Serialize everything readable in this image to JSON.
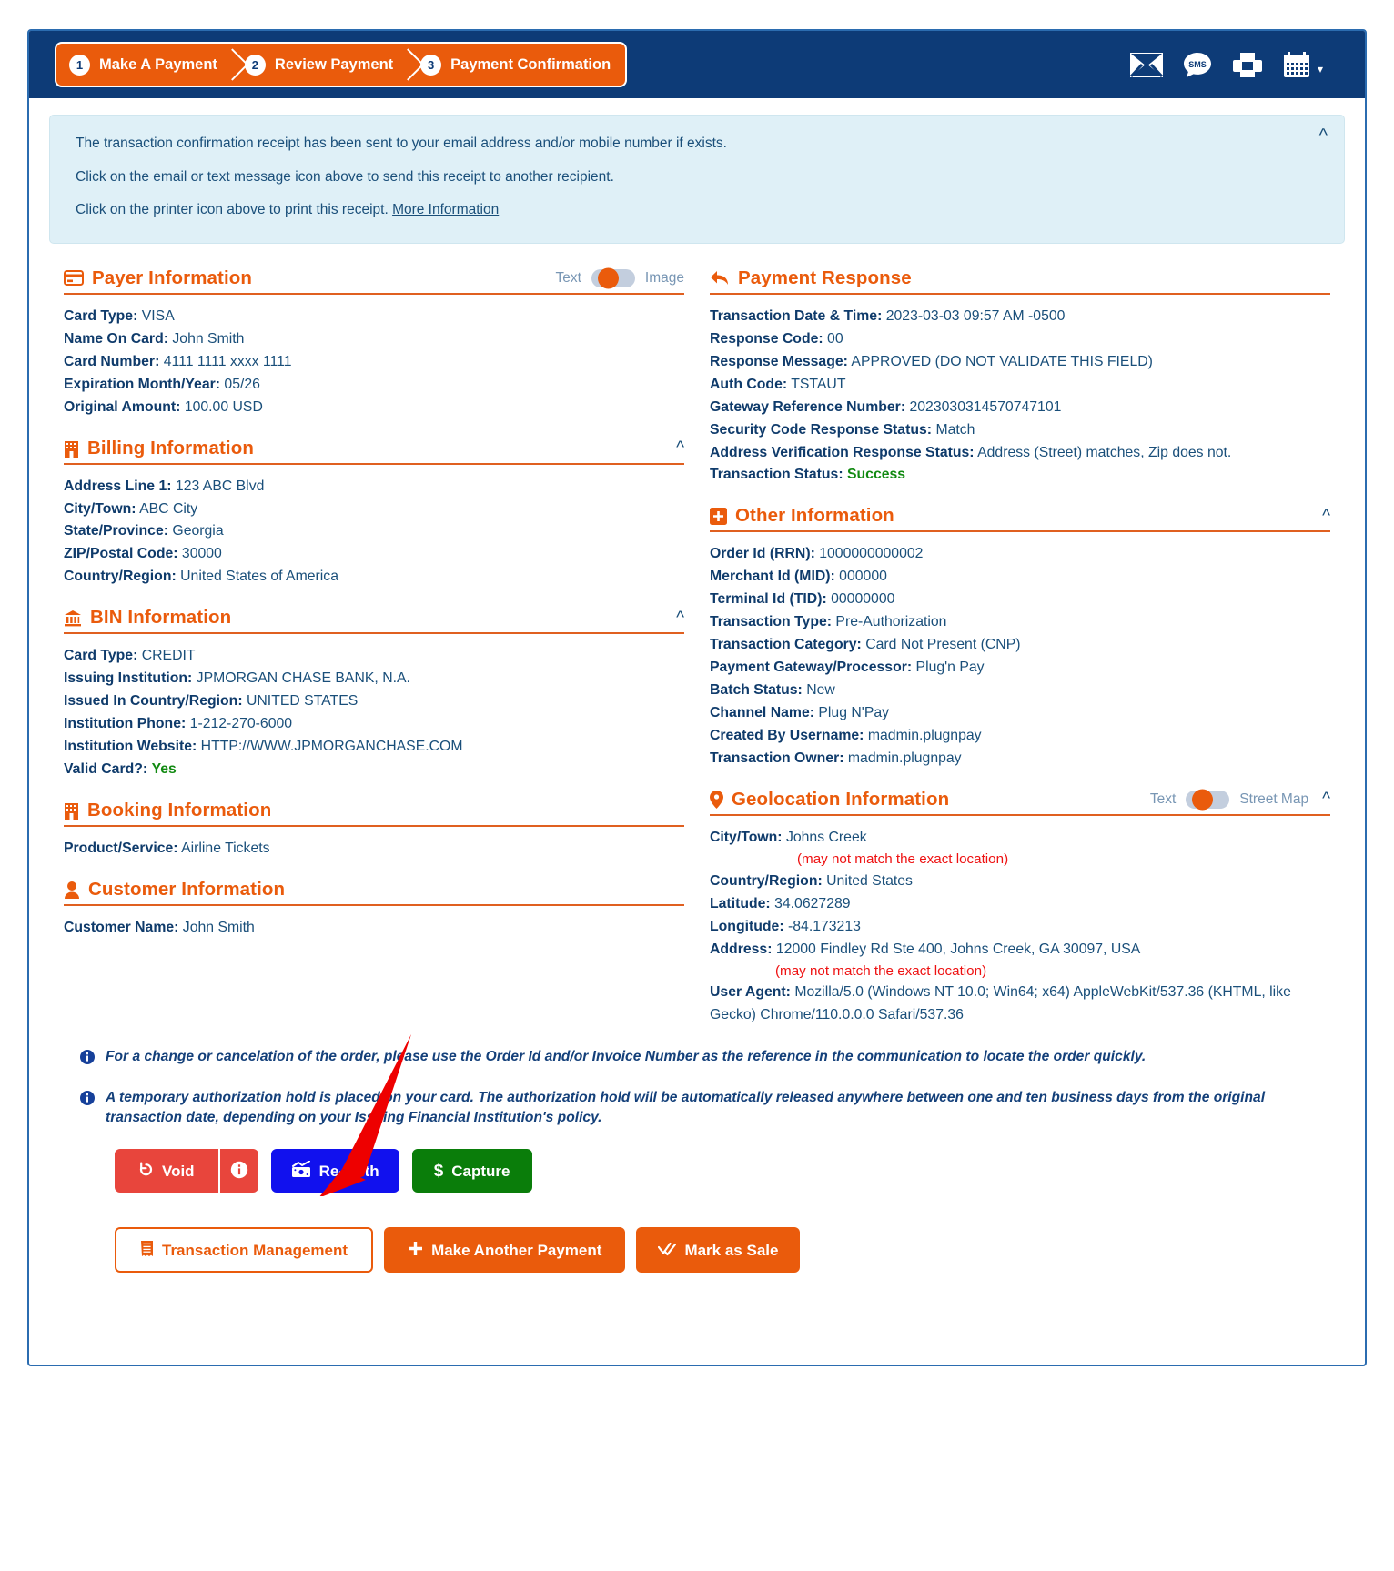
{
  "wizard": {
    "steps": [
      {
        "num": "1",
        "label": "Make A Payment"
      },
      {
        "num": "2",
        "label": "Review Payment"
      },
      {
        "num": "3",
        "label": "Payment Confirmation"
      }
    ]
  },
  "topbar": {
    "icons": [
      "email-icon",
      "sms-icon",
      "printer-icon",
      "calendar-icon"
    ],
    "accent": "#ea5b0c",
    "background": "#0d3b77"
  },
  "notice": {
    "line1": "The transaction confirmation receipt has been sent to your email address and/or mobile number if exists.",
    "line2": "Click on the email or text message icon above to send this receipt to another recipient.",
    "line3_prefix": "Click on the printer icon above to print this receipt. ",
    "line3_link": "More Information"
  },
  "sections": {
    "payer": {
      "title": "Payer Information",
      "toggle_left": "Text",
      "toggle_right": "Image",
      "fields": [
        {
          "k": "Card Type:",
          "v": "VISA"
        },
        {
          "k": "Name On Card:",
          "v": "John Smith"
        },
        {
          "k": "Card Number:",
          "v": "4111 1111 xxxx 1111"
        },
        {
          "k": "Expiration Month/Year:",
          "v": "05/26"
        },
        {
          "k": "Original Amount:",
          "v": "100.00 USD"
        }
      ]
    },
    "billing": {
      "title": "Billing Information",
      "fields": [
        {
          "k": "Address Line 1:",
          "v": "123 ABC Blvd"
        },
        {
          "k": "City/Town:",
          "v": "ABC City"
        },
        {
          "k": "State/Province:",
          "v": "Georgia"
        },
        {
          "k": "ZIP/Postal Code:",
          "v": "30000"
        },
        {
          "k": "Country/Region:",
          "v": "United States of America"
        }
      ]
    },
    "bin": {
      "title": "BIN Information",
      "fields": [
        {
          "k": "Card Type:",
          "v": "CREDIT"
        },
        {
          "k": "Issuing Institution:",
          "v": "JPMORGAN CHASE BANK, N.A."
        },
        {
          "k": "Issued In Country/Region:",
          "v": "UNITED STATES"
        },
        {
          "k": "Institution Phone:",
          "v": "1-212-270-6000"
        },
        {
          "k": "Institution Website:",
          "v": "HTTP://WWW.JPMORGANCHASE.COM"
        },
        {
          "k": "Valid Card?:",
          "v": "Yes",
          "style": "green"
        }
      ]
    },
    "booking": {
      "title": "Booking Information",
      "fields": [
        {
          "k": "Product/Service:",
          "v": "Airline Tickets"
        }
      ]
    },
    "customer": {
      "title": "Customer Information",
      "fields": [
        {
          "k": "Customer Name:",
          "v": "John Smith"
        }
      ]
    },
    "payment_response": {
      "title": "Payment Response",
      "fields": [
        {
          "k": "Transaction Date & Time:",
          "v": "2023-03-03 09:57 AM -0500"
        },
        {
          "k": "Response Code:",
          "v": "00"
        },
        {
          "k": "Response Message:",
          "v": "APPROVED (DO NOT VALIDATE THIS FIELD)"
        },
        {
          "k": "Auth Code:",
          "v": "TSTAUT"
        },
        {
          "k": "Gateway Reference Number:",
          "v": "2023030314570747101"
        },
        {
          "k": "Security Code Response Status:",
          "v": "Match"
        },
        {
          "k": "Address Verification Response Status:",
          "v": "Address (Street) matches, Zip does not."
        },
        {
          "k": "Transaction Status:",
          "v": "Success",
          "style": "green"
        }
      ]
    },
    "other": {
      "title": "Other Information",
      "fields": [
        {
          "k": "Order Id (RRN):",
          "v": "1000000000002"
        },
        {
          "k": "Merchant Id (MID):",
          "v": "000000"
        },
        {
          "k": "Terminal Id (TID):",
          "v": "00000000"
        },
        {
          "k": "Transaction Type:",
          "v": "Pre-Authorization"
        },
        {
          "k": "Transaction Category:",
          "v": "Card Not Present (CNP)"
        },
        {
          "k": "Payment Gateway/Processor:",
          "v": "Plug'n Pay"
        },
        {
          "k": "Batch Status:",
          "v": "New"
        },
        {
          "k": "Channel Name:",
          "v": "Plug N'Pay"
        },
        {
          "k": "Created By Username:",
          "v": "madmin.plugnpay"
        },
        {
          "k": "Transaction Owner:",
          "v": "madmin.plugnpay"
        }
      ]
    },
    "geolocation": {
      "title": "Geolocation Information",
      "toggle_left": "Text",
      "toggle_right": "Street Map",
      "city_key": "City/Town:",
      "city_value": "Johns Creek",
      "city_note": "(may not match the exact location)",
      "country_key": "Country/Region:",
      "country_value": "United States",
      "lat_key": "Latitude:",
      "lat_value": "34.0627289",
      "lon_key": "Longitude:",
      "lon_value": "-84.173213",
      "address_key": "Address:",
      "address_value": "12000 Findley Rd Ste 400, Johns Creek, GA 30097, USA",
      "address_note": "(may not match the exact location)",
      "ua_key": "User Agent:",
      "ua_value": "Mozilla/5.0 (Windows NT 10.0; Win64; x64) AppleWebKit/537.36 (KHTML, like Gecko) Chrome/110.0.0.0 Safari/537.36"
    }
  },
  "notes": [
    "For a change or cancelation of the order, please use the Order Id and/or Invoice Number as the reference in the communication to locate the order quickly.",
    "A temporary authorization hold is placed on your card. The authorization hold will be automatically released anywhere between one and ten business days from the original transaction date, depending on your Issuing Financial Institution's policy."
  ],
  "buttons": {
    "void": "Void",
    "reauth": "Re-Auth",
    "capture": "Capture",
    "transaction_management": "Transaction Management",
    "make_another_payment": "Make Another Payment",
    "mark_as_sale": "Mark as Sale"
  },
  "colors": {
    "brand_orange": "#ea5b0c",
    "header_blue": "#0d3b77",
    "text_blue": "#1a4f7a",
    "success_green": "#128a12",
    "warning_red": "#ee1111",
    "void_red": "#e8453c",
    "reauth_blue": "#1111ee",
    "capture_green": "#0a7d0a"
  }
}
